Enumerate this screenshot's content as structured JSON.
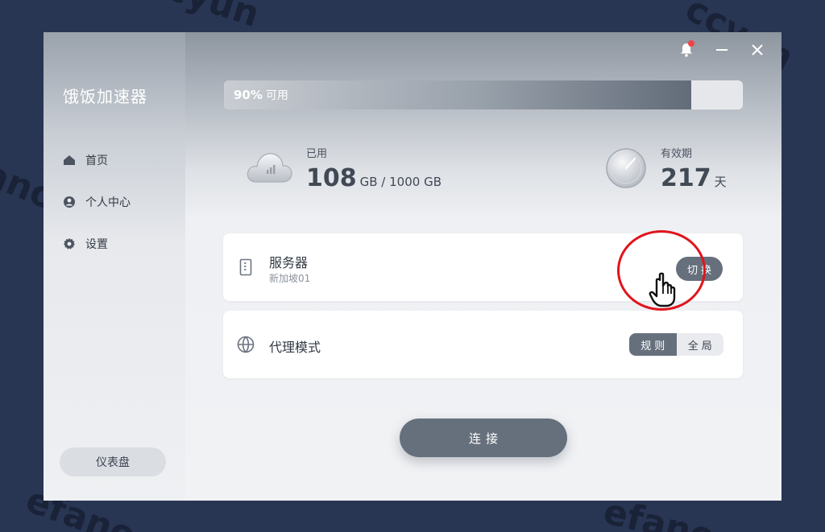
{
  "app": {
    "title": "饿饭加速器"
  },
  "sidebar": {
    "items": [
      {
        "label": "首页",
        "icon": "home-icon"
      },
      {
        "label": "个人中心",
        "icon": "user-icon"
      },
      {
        "label": "设置",
        "icon": "gear-icon"
      }
    ],
    "dashboard_label": "仪表盘"
  },
  "header": {
    "icons": [
      "bell-icon",
      "minimize-icon",
      "close-icon"
    ],
    "notification_dot_color": "#f2434a"
  },
  "quota": {
    "percent_label": "90%",
    "available_label": "可用",
    "fill_fraction": 0.9
  },
  "usage": {
    "label": "已用",
    "used": "108",
    "unit_total": "GB / 1000 GB",
    "icon": "cloud-chart-icon"
  },
  "validity": {
    "label": "有效期",
    "days": "217",
    "unit": "天",
    "icon": "clock-icon"
  },
  "server": {
    "title": "服务器",
    "subtitle": "新加坡01",
    "switch_label": "切换",
    "icon": "server-icon"
  },
  "proxy": {
    "title": "代理模式",
    "icon": "globe-icon",
    "options": [
      "规则",
      "全局"
    ],
    "selected": "规则"
  },
  "connect_label": "连接",
  "colors": {
    "accent": "#66707d",
    "background": "#283653",
    "highlight": "#e0141c"
  },
  "watermark_text": [
    "ccyun",
    "ccyun",
    "efano",
    "efano",
    "efano"
  ]
}
